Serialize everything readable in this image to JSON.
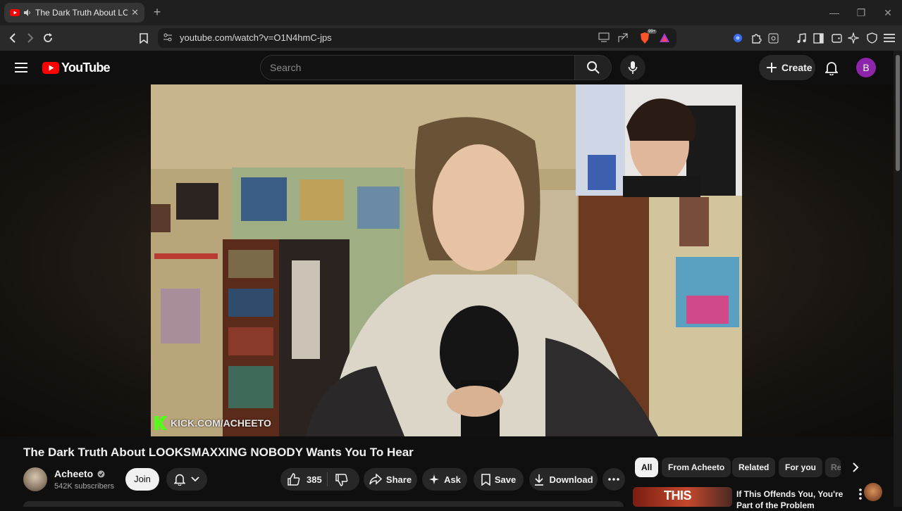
{
  "browser": {
    "tab_title": "The Dark Truth About LOOKSMAXXING NOBODY Wants You To Hear",
    "url": "youtube.com/watch?v=O1N4hmC-jps",
    "brave_badge": "99+"
  },
  "header": {
    "logo_text": "YouTube",
    "search_placeholder": "Search",
    "create_label": "Create",
    "avatar_letter": "B"
  },
  "video": {
    "watermark": "KICK.COM/ACHEETO",
    "title": "The Dark Truth About LOOKSMAXXING NOBODY Wants You To Hear"
  },
  "channel": {
    "name": "Acheeto",
    "subscribers": "542K subscribers",
    "join_label": "Join"
  },
  "actions": {
    "like_count": "385",
    "share_label": "Share",
    "ask_label": "Ask",
    "save_label": "Save",
    "download_label": "Download"
  },
  "chips": [
    "All",
    "From Acheeto",
    "Related",
    "For you",
    "Re"
  ],
  "recommendation": {
    "title": "If This Offends You, You're Part of the Problem",
    "thumb_text": "THIS"
  },
  "colors": {
    "youtube_red": "#ff0000",
    "avatar_purple": "#8e24aa",
    "background": "#0f0f0f"
  }
}
